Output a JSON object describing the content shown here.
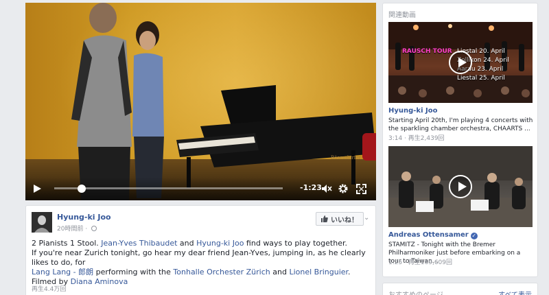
{
  "video": {
    "time_remaining": "-1:23",
    "progress_fraction": 0.12
  },
  "post": {
    "author": "Hyung-ki Joo",
    "timestamp": "20時間前",
    "meta_separator": "·",
    "like_button": "いいね！",
    "body": {
      "line1_a": "2 Pianists 1 Stool. ",
      "line1_link1": "Jean-Yves Thibaudet",
      "line1_b": " and ",
      "line1_link2": "Hyung-ki Joo",
      "line1_c": " find ways to play together.",
      "line2": "If you're near Zurich tonight, go hear my dear friend Jean-Yves, jumping in, as he clearly likes to do, for",
      "line3_link1": "Lang Lang - 郎朗",
      "line3_a": " performing with the ",
      "line3_link2": "Tonhalle Orchester Zürich",
      "line3_b": " and ",
      "line3_link3": "Lionel Bringuier",
      "line3_c": ".",
      "line4_a": "Filmed by ",
      "line4_link": "Diana Aminova"
    },
    "views": "再生4.4万回"
  },
  "sidebar": {
    "heading": "関連動画",
    "videos": [
      {
        "overlay_title": "RAUSCH TOUR",
        "overlay_dates": [
          "Liestal 20. April",
          "Zollikon 24. April",
          "Aarau 23. April",
          "Liestal 25. April"
        ],
        "title": "Hyung-ki Joo",
        "description": "Starting April 20th, I'm playing 4 concerts with the sparkling chamber orchestra, CHAARTS ...",
        "meta": "3:14 · 再生2,439回"
      },
      {
        "title": "Andreas Ottensamer",
        "verified": true,
        "description": "STAMITZ - Tonight with the Bremer Philharmoniker just before embarking on a tour to Taiwan...",
        "meta": "1:25 · 再生169,609回"
      }
    ]
  },
  "recommended": {
    "heading": "おすすめのページ",
    "see_all": "すべて表示"
  },
  "colors": {
    "link": "#365899",
    "background": "#e9ebee",
    "muted": "#90949c"
  }
}
